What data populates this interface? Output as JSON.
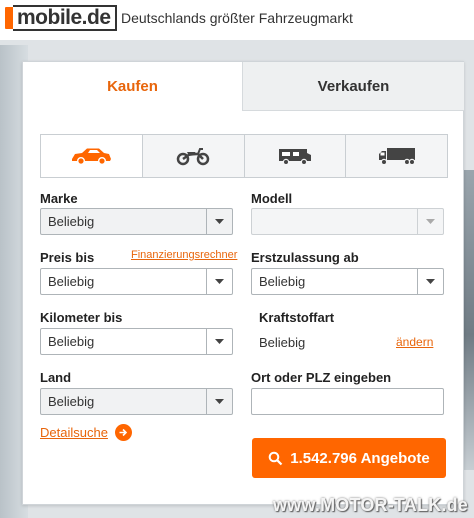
{
  "header": {
    "logo_text": "mobile.de",
    "tagline": "Deutschlands größter Fahrzeugmarkt"
  },
  "tabs": [
    {
      "label": "Kaufen",
      "active": true
    },
    {
      "label": "Verkaufen",
      "active": false
    }
  ],
  "vehicle_types": [
    {
      "icon": "car-icon",
      "active": true
    },
    {
      "icon": "motorcycle-icon",
      "active": false
    },
    {
      "icon": "camper-icon",
      "active": false
    },
    {
      "icon": "truck-icon",
      "active": false
    }
  ],
  "form": {
    "marke": {
      "label": "Marke",
      "value": "Beliebig"
    },
    "modell": {
      "label": "Modell",
      "value": ""
    },
    "preis": {
      "label": "Preis bis",
      "value": "Beliebig",
      "link": "Finanzierungsrechner"
    },
    "erstzulassung": {
      "label": "Erstzulassung ab",
      "value": "Beliebig"
    },
    "kilometer": {
      "label": "Kilometer bis",
      "value": "Beliebig"
    },
    "kraftstoff": {
      "label": "Kraftstoffart",
      "value": "Beliebig",
      "link": "ändern"
    },
    "land": {
      "label": "Land",
      "value": "Beliebig"
    },
    "ort": {
      "label": "Ort oder PLZ eingeben",
      "value": ""
    }
  },
  "footer": {
    "detail_link": "Detailsuche",
    "cta_label": "1.542.796 Angebote"
  },
  "watermark": "www.MOTOR-TALK.de",
  "colors": {
    "accent": "#ff6600",
    "active_tab_text": "#e8650b"
  }
}
